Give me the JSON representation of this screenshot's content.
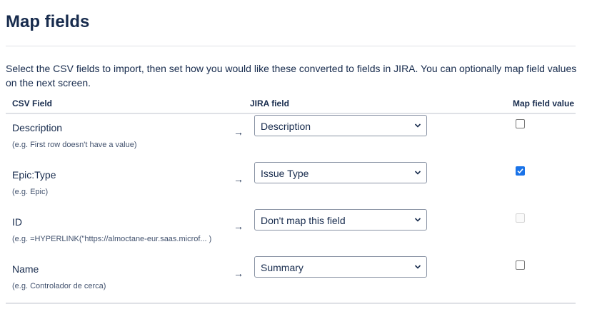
{
  "page": {
    "title": "Map fields",
    "description": "Select the CSV fields to import, then set how you would like these converted to fields in JIRA. You can optionally map field values on the next screen."
  },
  "table": {
    "headers": {
      "csv_field": "CSV Field",
      "jira_field": "JIRA field",
      "map_field_value": "Map field value"
    },
    "arrow": "→",
    "rows": [
      {
        "csv_field": "Description",
        "example": "(e.g. First row doesn't have a value)",
        "jira_field": "Description",
        "map_value_checked": false,
        "map_value_disabled": false
      },
      {
        "csv_field": "Epic:Type",
        "example": "(e.g. Epic)",
        "jira_field": "Issue Type",
        "map_value_checked": true,
        "map_value_disabled": false
      },
      {
        "csv_field": "ID",
        "example": "(e.g. =HYPERLINK(\"https://almoctane-eur.saas.microf... )",
        "jira_field": "Don't map this field",
        "map_value_checked": false,
        "map_value_disabled": true
      },
      {
        "csv_field": "Name",
        "example": "(e.g. Controlador de cerca)",
        "jira_field": "Summary",
        "map_value_checked": false,
        "map_value_disabled": false
      }
    ]
  }
}
